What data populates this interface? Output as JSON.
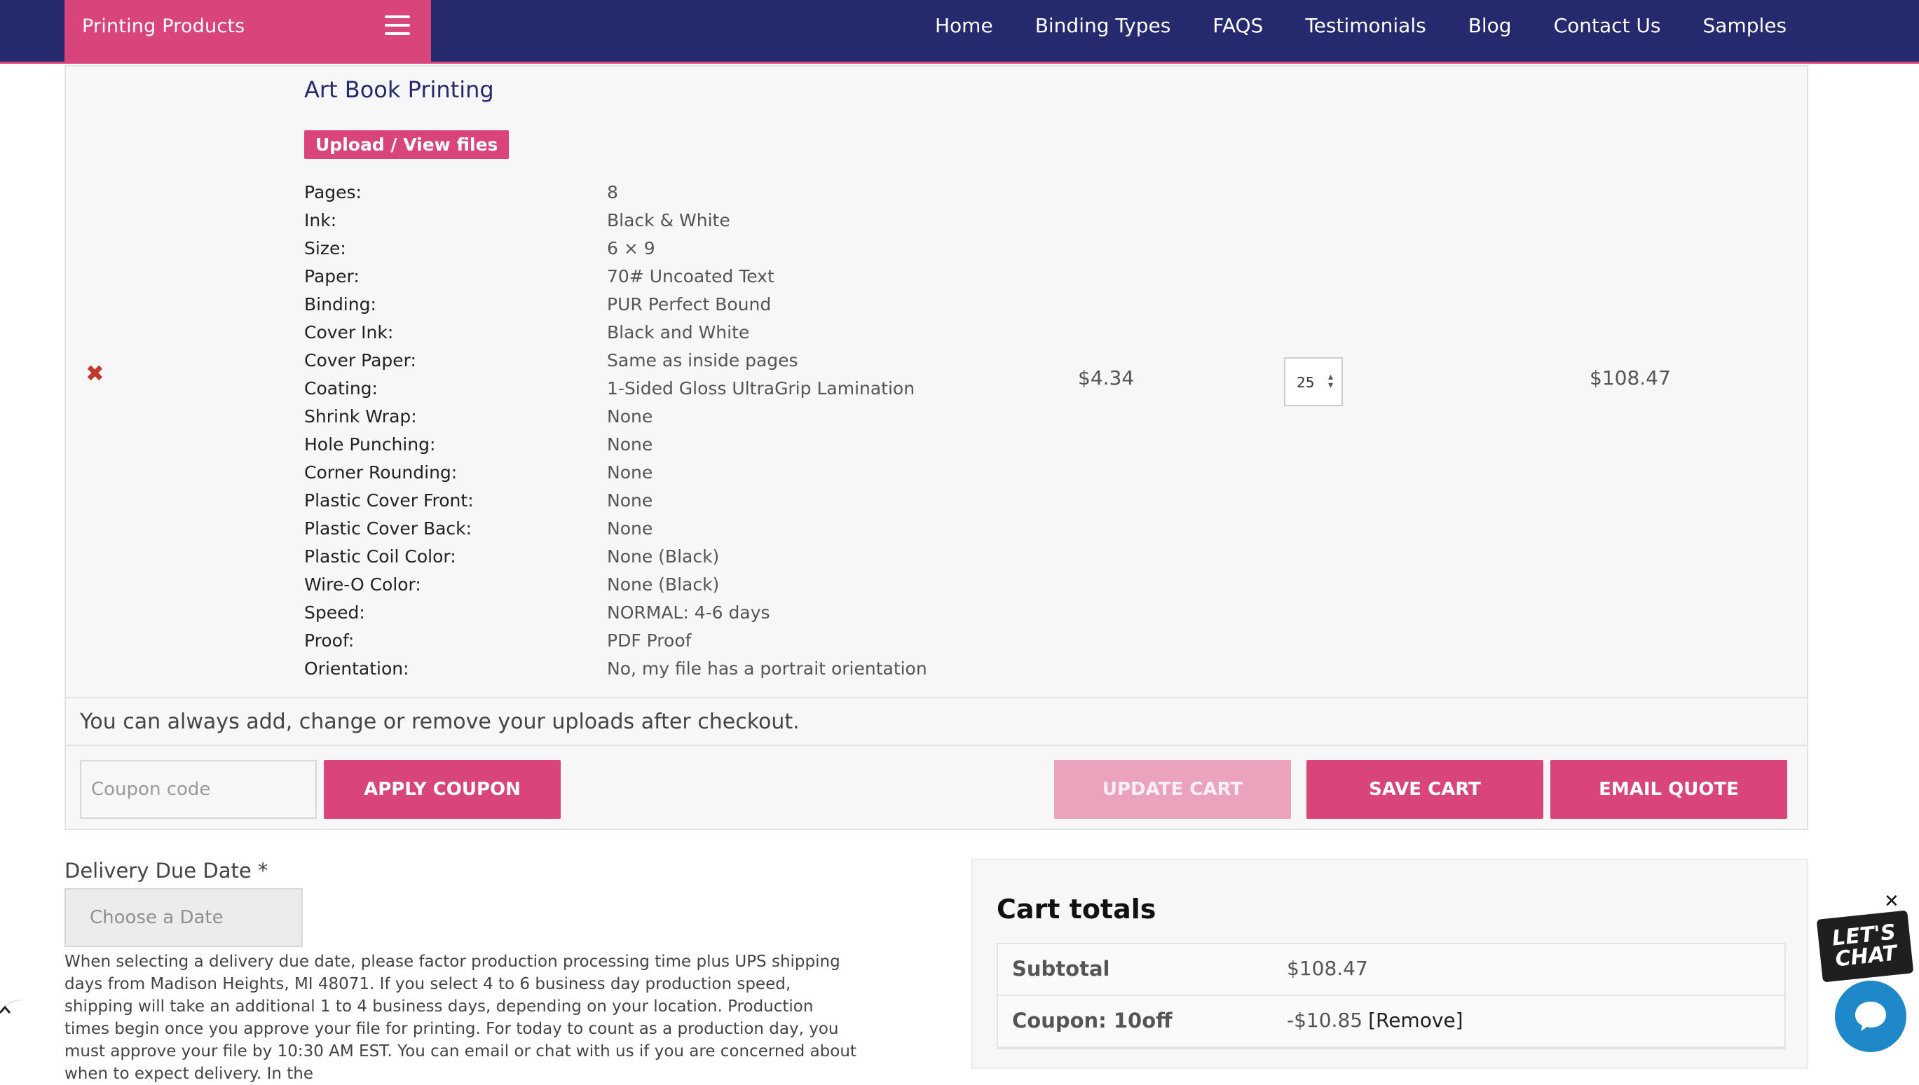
{
  "navbar": {
    "brand": "Printing Products",
    "links": [
      "Home",
      "Binding Types",
      "FAQS",
      "Testimonials",
      "Blog",
      "Contact Us",
      "Samples"
    ]
  },
  "cart_item": {
    "title": "Art Book Printing",
    "upload_button": "Upload / View files",
    "specs": [
      {
        "label": "Pages:",
        "value": "8"
      },
      {
        "label": "Ink:",
        "value": "Black & White"
      },
      {
        "label": "Size:",
        "value": "6 × 9"
      },
      {
        "label": "Paper:",
        "value": "70# Uncoated Text"
      },
      {
        "label": "Binding:",
        "value": "PUR Perfect Bound"
      },
      {
        "label": "Cover Ink:",
        "value": "Black and White"
      },
      {
        "label": "Cover Paper:",
        "value": "Same as inside pages"
      },
      {
        "label": "Coating:",
        "value": "1-Sided Gloss UltraGrip Lamination"
      },
      {
        "label": "Shrink Wrap:",
        "value": "None"
      },
      {
        "label": "Hole Punching:",
        "value": "None"
      },
      {
        "label": "Corner Rounding:",
        "value": "None"
      },
      {
        "label": "Plastic Cover Front:",
        "value": "None"
      },
      {
        "label": "Plastic Cover Back:",
        "value": "None"
      },
      {
        "label": "Plastic Coil Color:",
        "value": "None (Black)"
      },
      {
        "label": "Wire-O Color:",
        "value": "None (Black)"
      },
      {
        "label": "Speed:",
        "value": "NORMAL: 4-6 days"
      },
      {
        "label": "Proof:",
        "value": "PDF Proof"
      },
      {
        "label": "Orientation:",
        "value": "No, my file has a portrait orientation"
      }
    ],
    "remove_glyph": "✖",
    "unit_price": "$4.34",
    "quantity": "25",
    "line_total": "$108.47"
  },
  "upload_note": "You can always add, change or remove your uploads after checkout.",
  "coupon": {
    "placeholder": "Coupon code",
    "apply_label": "APPLY COUPON"
  },
  "cart_actions": {
    "update_label": "UPDATE CART",
    "save_label": "SAVE CART",
    "email_label": "EMAIL QUOTE"
  },
  "delivery": {
    "label": "Delivery Due Date *",
    "placeholder": "Choose a Date",
    "help_text": "When selecting a delivery due date, please factor production processing time plus UPS shipping days from Madison Heights, MI 48071. If you select 4 to 6 business day production speed, shipping will take an additional 1 to 4 business days, depending on your location. Production times begin once you approve your file for printing. For today to count as a production day, you must approve your file by 10:30 AM EST. You can email or chat with us if you are concerned about when to expect delivery. In the"
  },
  "cart_totals": {
    "heading": "Cart totals",
    "rows": [
      {
        "label": "Subtotal",
        "value": "$108.47"
      },
      {
        "label": "Coupon: 10off",
        "value": "-$10.85",
        "link": "[Remove]"
      }
    ]
  },
  "chat": {
    "badge_line1": "LET'S",
    "badge_line2": "CHAT",
    "close_glyph": "✕"
  },
  "colors": {
    "nav_bg": "#252a6e",
    "accent": "#d9447a",
    "accent_disabled": "#eba3bd",
    "chat_blue": "#1e88c9"
  }
}
